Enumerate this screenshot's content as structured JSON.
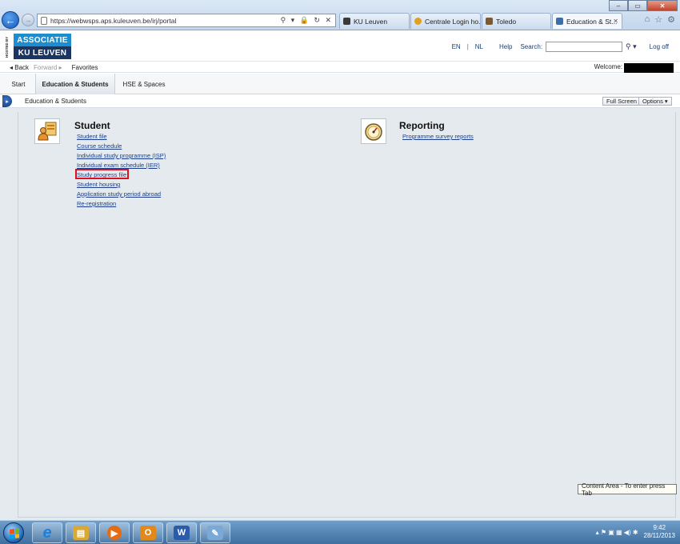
{
  "browser": {
    "url": "https://webwsps.aps.kuleuven.be/irj/portal",
    "address_tools": "⚲ ▾ 🔒 ↻ ✕",
    "tabs": [
      {
        "label": "KU Leuven",
        "color": "#3a3a3a"
      },
      {
        "label": "Centrale Login ho...",
        "color": "#e0a020"
      },
      {
        "label": "Toledo",
        "color": "#7a5a30"
      },
      {
        "label": "Education & St...",
        "color": "#3e6ea8"
      }
    ],
    "window_buttons": {
      "minimize": "–",
      "maximize": "▭",
      "close": "✕"
    },
    "ie_icons": {
      "home": "⌂",
      "favorites": "☆",
      "tools": "⚙"
    }
  },
  "header": {
    "hosted_by": "HOSTED BY",
    "logo_top": "ASSOCIATIE",
    "logo_bottom": "KU LEUVEN",
    "lang_en": "EN",
    "lang_sep": "|",
    "lang_nl": "NL",
    "help": "Help",
    "search_label": "Search:",
    "search_value": "",
    "search_icon": "⚲ ▾",
    "logoff": "Log off"
  },
  "navbar": {
    "back": "◂ Back",
    "forward": "Forward ▸",
    "favorites": "Favorites",
    "welcome": "Welcome:"
  },
  "portal_tabs": [
    {
      "label": "Start",
      "active": false
    },
    {
      "label": "Education & Students",
      "active": true
    },
    {
      "label": "HSE & Spaces",
      "active": false
    }
  ],
  "subbar": {
    "breadcrumb": "Education & Students",
    "full_screen": "Full Screen",
    "options": "Options ▾",
    "side_arrow": "▸"
  },
  "student": {
    "title": "Student",
    "links": [
      "Student file",
      "Course schedule",
      "Individual study programme (ISP)",
      "Individual exam schedule (IER)",
      "Study progress file",
      "Student housing",
      "Application study period abroad",
      "Re-registration"
    ]
  },
  "reporting": {
    "title": "Reporting",
    "links": [
      "Programme survey reports"
    ]
  },
  "tooltip": "Content Area - To enter press Tab",
  "taskbar": {
    "apps": [
      {
        "name": "internet-explorer",
        "glyph": "e",
        "color": "#1e7fd8"
      },
      {
        "name": "file-explorer",
        "glyph": "▤",
        "color": "#d9a935"
      },
      {
        "name": "media-player",
        "glyph": "▶",
        "color": "#e76b10"
      },
      {
        "name": "outlook",
        "glyph": "O",
        "color": "#e18a1b"
      },
      {
        "name": "word",
        "glyph": "W",
        "color": "#2a5caa"
      },
      {
        "name": "paint",
        "glyph": "✎",
        "color": "#7aa9d8"
      }
    ],
    "tray_icons": "▴  ⚑  ▣  ▦  ◀)  ✱",
    "time": "9:42",
    "date": "28/11/2013"
  }
}
